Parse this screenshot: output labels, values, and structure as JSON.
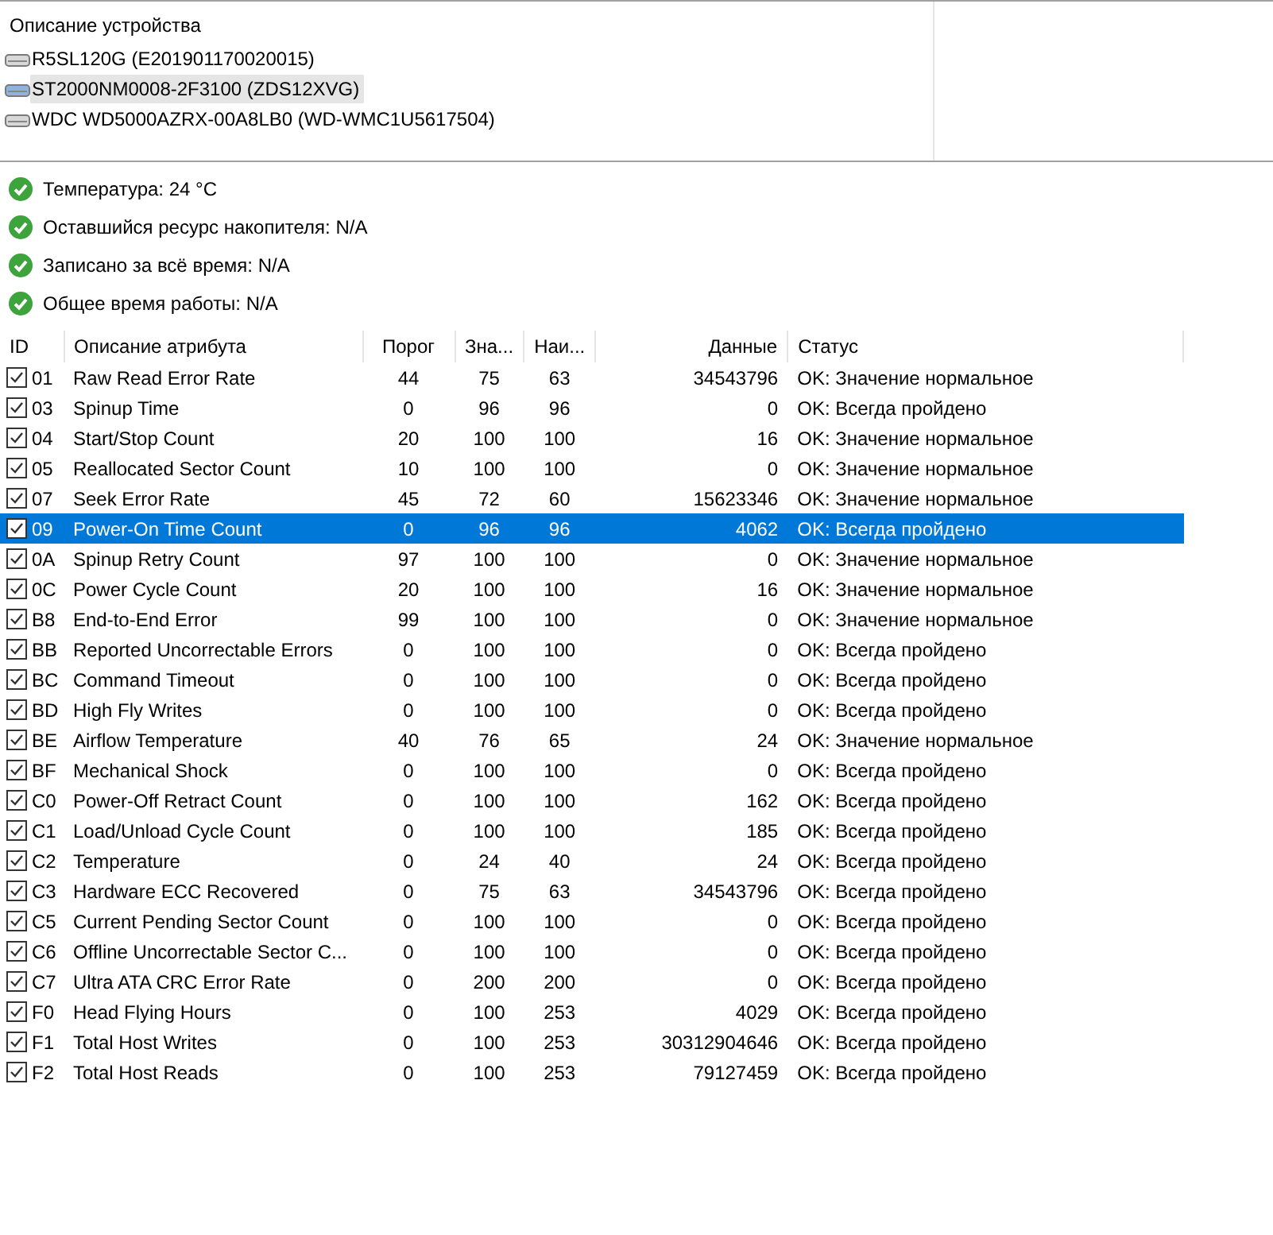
{
  "devices": {
    "header": "Описание устройства",
    "items": [
      {
        "name": "R5SL120G (E201901170020015)",
        "selected": false
      },
      {
        "name": "ST2000NM0008-2F3100 (ZDS12XVG)",
        "selected": true
      },
      {
        "name": "WDC WD5000AZRX-00A8LB0 (WD-WMC1U5617504)",
        "selected": false
      }
    ]
  },
  "health": [
    {
      "text": "Температура: 24 °C"
    },
    {
      "text": "Оставшийся ресурс накопителя: N/A"
    },
    {
      "text": "Записано за всё время: N/A"
    },
    {
      "text": "Общее время работы: N/A"
    }
  ],
  "table": {
    "columns": [
      "ID",
      "Описание атрибута",
      "Порог",
      "Зна...",
      "Наи...",
      "Данные",
      "Статус"
    ],
    "rows": [
      {
        "checked": true,
        "selected": false,
        "cells": [
          "01",
          "Raw Read Error Rate",
          "44",
          "75",
          "63",
          "34543796",
          "OK: Значение нормальное"
        ]
      },
      {
        "checked": true,
        "selected": false,
        "cells": [
          "03",
          "Spinup Time",
          "0",
          "96",
          "96",
          "0",
          "OK: Всегда пройдено"
        ]
      },
      {
        "checked": true,
        "selected": false,
        "cells": [
          "04",
          "Start/Stop Count",
          "20",
          "100",
          "100",
          "16",
          "OK: Значение нормальное"
        ]
      },
      {
        "checked": true,
        "selected": false,
        "cells": [
          "05",
          "Reallocated Sector Count",
          "10",
          "100",
          "100",
          "0",
          "OK: Значение нормальное"
        ]
      },
      {
        "checked": true,
        "selected": false,
        "cells": [
          "07",
          "Seek Error Rate",
          "45",
          "72",
          "60",
          "15623346",
          "OK: Значение нормальное"
        ]
      },
      {
        "checked": true,
        "selected": true,
        "cells": [
          "09",
          "Power-On Time Count",
          "0",
          "96",
          "96",
          "4062",
          "OK: Всегда пройдено"
        ]
      },
      {
        "checked": true,
        "selected": false,
        "cells": [
          "0A",
          "Spinup Retry Count",
          "97",
          "100",
          "100",
          "0",
          "OK: Значение нормальное"
        ]
      },
      {
        "checked": true,
        "selected": false,
        "cells": [
          "0C",
          "Power Cycle Count",
          "20",
          "100",
          "100",
          "16",
          "OK: Значение нормальное"
        ]
      },
      {
        "checked": true,
        "selected": false,
        "cells": [
          "B8",
          "End-to-End Error",
          "99",
          "100",
          "100",
          "0",
          "OK: Значение нормальное"
        ]
      },
      {
        "checked": true,
        "selected": false,
        "cells": [
          "BB",
          "Reported Uncorrectable Errors",
          "0",
          "100",
          "100",
          "0",
          "OK: Всегда пройдено"
        ]
      },
      {
        "checked": true,
        "selected": false,
        "cells": [
          "BC",
          "Command Timeout",
          "0",
          "100",
          "100",
          "0",
          "OK: Всегда пройдено"
        ]
      },
      {
        "checked": true,
        "selected": false,
        "cells": [
          "BD",
          "High Fly Writes",
          "0",
          "100",
          "100",
          "0",
          "OK: Всегда пройдено"
        ]
      },
      {
        "checked": true,
        "selected": false,
        "cells": [
          "BE",
          "Airflow Temperature",
          "40",
          "76",
          "65",
          "24",
          "OK: Значение нормальное"
        ]
      },
      {
        "checked": true,
        "selected": false,
        "cells": [
          "BF",
          "Mechanical Shock",
          "0",
          "100",
          "100",
          "0",
          "OK: Всегда пройдено"
        ]
      },
      {
        "checked": true,
        "selected": false,
        "cells": [
          "C0",
          "Power-Off Retract Count",
          "0",
          "100",
          "100",
          "162",
          "OK: Всегда пройдено"
        ]
      },
      {
        "checked": true,
        "selected": false,
        "cells": [
          "C1",
          "Load/Unload Cycle Count",
          "0",
          "100",
          "100",
          "185",
          "OK: Всегда пройдено"
        ]
      },
      {
        "checked": true,
        "selected": false,
        "cells": [
          "C2",
          "Temperature",
          "0",
          "24",
          "40",
          "24",
          "OK: Всегда пройдено"
        ]
      },
      {
        "checked": true,
        "selected": false,
        "cells": [
          "C3",
          "Hardware ECC Recovered",
          "0",
          "75",
          "63",
          "34543796",
          "OK: Всегда пройдено"
        ]
      },
      {
        "checked": true,
        "selected": false,
        "cells": [
          "C5",
          "Current Pending Sector Count",
          "0",
          "100",
          "100",
          "0",
          "OK: Всегда пройдено"
        ]
      },
      {
        "checked": true,
        "selected": false,
        "cells": [
          "C6",
          "Offline Uncorrectable Sector C...",
          "0",
          "100",
          "100",
          "0",
          "OK: Всегда пройдено"
        ]
      },
      {
        "checked": true,
        "selected": false,
        "cells": [
          "C7",
          "Ultra ATA CRC Error Rate",
          "0",
          "200",
          "200",
          "0",
          "OK: Всегда пройдено"
        ]
      },
      {
        "checked": true,
        "selected": false,
        "cells": [
          "F0",
          "Head Flying Hours",
          "0",
          "100",
          "253",
          "4029",
          "OK: Всегда пройдено"
        ]
      },
      {
        "checked": true,
        "selected": false,
        "cells": [
          "F1",
          "Total Host Writes",
          "0",
          "100",
          "253",
          "30312904646",
          "OK: Всегда пройдено"
        ]
      },
      {
        "checked": true,
        "selected": false,
        "cells": [
          "F2",
          "Total Host Reads",
          "0",
          "100",
          "253",
          "79127459",
          "OK: Всегда пройдено"
        ]
      }
    ]
  }
}
